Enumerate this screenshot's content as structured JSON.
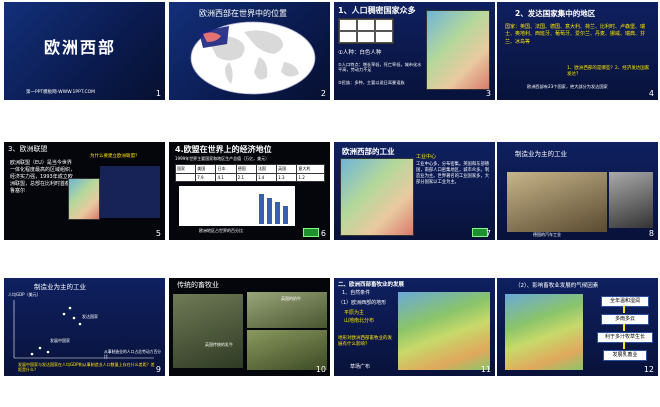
{
  "slides": [
    {
      "num": "1",
      "title": "欧洲西部",
      "footer": "第一PPT模板网-WWW.1PPT.COM"
    },
    {
      "num": "2",
      "title": "欧洲西部在世界中的位置"
    },
    {
      "num": "3",
      "title": "1、人口稠密国家众多",
      "bullets": [
        "①人种：白色人种",
        "②人口特点：增长率低，死亡率低，城市化水平高，劳动力不足",
        "③民族：多种，主要以说日耳曼语族"
      ]
    },
    {
      "num": "4",
      "title": "2、发达国家集中的地区",
      "body": "国家：英国、法国、德国、意大利、荷兰、比利时、卢森堡、瑞士、奥地利、西班牙、葡萄牙、爱尔兰、丹麦、挪威、瑞典、芬兰、冰岛等",
      "question": "1、欧洲西部的是哪些？2、经济发达国家发达？",
      "note": "欧洲西部有23个国家，绝大部分为发达国家"
    },
    {
      "num": "5",
      "title": "3、欧洲联盟",
      "body": "欧洲联盟（EU）是当今世界一体化程度最高的区域组织，经济实力强，1993年成立欧洲联盟，总部在比利时首都布鲁塞尔",
      "question": "为什么要建立欧洲联盟？"
    },
    {
      "num": "6",
      "title": "4.欧盟在世界上的经济地位",
      "subtitle": "1999年世界主要国家和地区生产总值（万亿，美元）",
      "headers": [
        "国家",
        "美国",
        "日本",
        "德国",
        "法国",
        "英国",
        "意大利"
      ],
      "values": [
        "7.9",
        "4.1",
        "2.1",
        "1.4",
        "1.3",
        "1.2"
      ],
      "chart_caption": "欧洲地区占世界的百分比"
    },
    {
      "num": "7",
      "title": "欧洲西部的工业",
      "body": "工业中心多，分布密集。英国和东部德国，南部人口密集地区，城市众多。制造业为主。世界著名的工业国家多，大部分国家以工业为主。",
      "subtitle": "工业中心"
    },
    {
      "num": "8",
      "title": "制造业为主的工业",
      "caption": "德国的汽车工业"
    },
    {
      "num": "9",
      "title": "制造业为主的工业",
      "question": "发展中国家与发达国家在人均GDP和从事制造业人口数量上存在什么差距？差距是什么？",
      "labels": [
        "人均GDP（美元）",
        "从事制造业的人口占总劳动力百分比",
        "发展中国家",
        "发达国家"
      ]
    },
    {
      "num": "10",
      "title": "传统的畜牧业",
      "caption1": "英国传统的乳牛",
      "caption2": "英国的奶牛"
    },
    {
      "num": "11",
      "title": "二、欧洲西部畜牧业的发展",
      "bullets": [
        "1、自然条件",
        "（1）欧洲西部的地形",
        "平原为主",
        "山地南北分布"
      ],
      "question": "地形对欧洲西部畜牧业的发展有什么影响？",
      "footer_label": "草场广布"
    },
    {
      "num": "12",
      "title": "（2）、影响畜牧业发展的气候因素",
      "boxes": [
        "全年温和湿润",
        "多雨多云",
        "利于多汁牧草生长",
        "发展乳畜业"
      ]
    }
  ]
}
